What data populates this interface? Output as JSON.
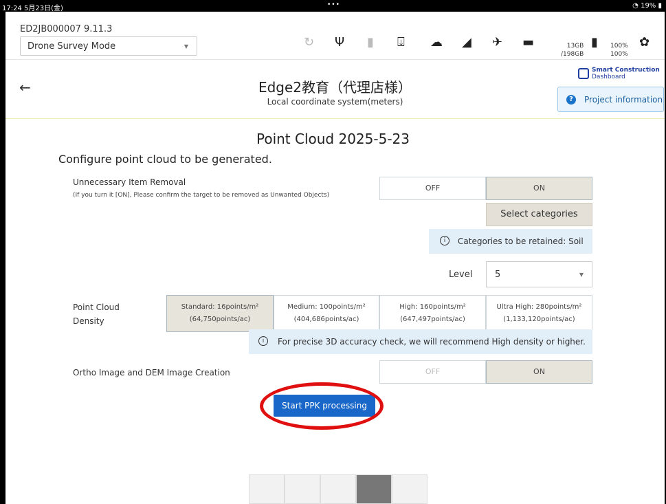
{
  "statusbar": {
    "time": "17:24  5月23日(金)",
    "dots": "•••",
    "battery": "19%"
  },
  "toolbar": {
    "device_id": "ED2JB000007   9.11.3",
    "mode": "Drone Survey Mode",
    "storage_used": "13GB",
    "storage_total": "/198GB",
    "battery_a": "100%",
    "battery_b": "100%",
    "icons": [
      "refresh-icon",
      "usb-icon",
      "sd-card-icon",
      "download-icon",
      "cloud-icon",
      "signal-icon",
      "satellite-icon",
      "folder-icon",
      "battery-icon",
      "gear-icon"
    ]
  },
  "header": {
    "title": "Edge2教育（代理店様）",
    "subtitle": "Local coordinate system(meters)",
    "logo_line1": "Smart Construction",
    "logo_line2": "Dashboard",
    "project_info": "Project information",
    "project_info_icon": "?"
  },
  "main": {
    "title": "Point Cloud 2025-5-23",
    "configure": "Configure point cloud to be generated.",
    "removal": {
      "label": "Unnecessary Item Removal",
      "note": "(If you turn it [ON], Please confirm the target to be removed as Unwanted Objects)",
      "off": "OFF",
      "on": "ON",
      "select_categories": "Select categories",
      "retained_info": "Categories to be retained: Soil",
      "level_label": "Level",
      "level_value": "5"
    },
    "density": {
      "label_line1": "Point Cloud",
      "label_line2": "Density",
      "options": [
        {
          "line1": "Standard: 16points/m²",
          "line2": "(64,750points/ac)"
        },
        {
          "line1": "Medium: 100points/m²",
          "line2": "(404,686points/ac)"
        },
        {
          "line1": "High: 160points/m²",
          "line2": "(647,497points/ac)"
        },
        {
          "line1": "Ultra High: 280points/m²",
          "line2": "(1,133,120points/ac)"
        }
      ],
      "info": "For precise 3D accuracy check, we will recommend High density or higher."
    },
    "ortho": {
      "label": "Ortho Image and DEM Image Creation",
      "off": "OFF",
      "on": "ON"
    },
    "start_button": "Start PPK processing",
    "info_icon": "i"
  },
  "colors": {
    "accent": "#1967c9",
    "highlight": "#e01010",
    "selected": "#e7e4dc"
  }
}
